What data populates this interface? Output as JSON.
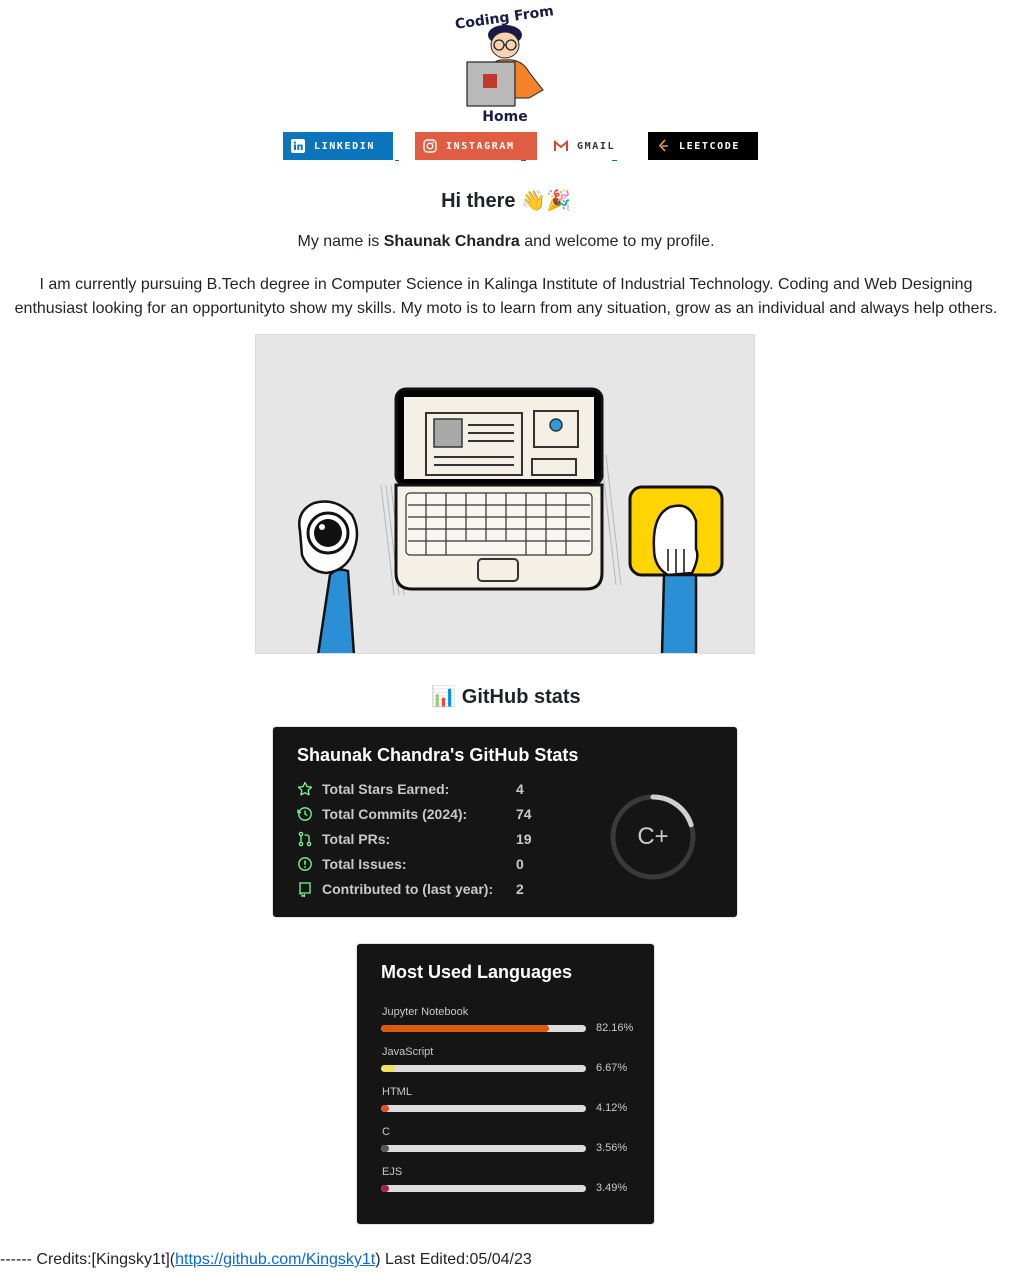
{
  "logo": {
    "top_text": "Coding From",
    "bottom_text": "Home"
  },
  "badges": [
    {
      "label": "LINKEDIN",
      "icon": "linkedin-icon",
      "color": "#0a75bd"
    },
    {
      "label": "INSTAGRAM",
      "icon": "instagram-icon",
      "color": "#e05d44"
    },
    {
      "label": "GMAIL",
      "icon": "gmail-icon",
      "color": "#ffffff"
    },
    {
      "label": "LEETCODE",
      "icon": "leetcode-icon",
      "color": "#000000"
    }
  ],
  "intro": {
    "greeting": "Hi there 👋🎉",
    "name_prefix": "My name is ",
    "name": "Shaunak Chandra",
    "name_suffix": " and welcome to my profile.",
    "bio_line1": "I am currently pursuing B.Tech degree in Computer Science in Kalinga Institute of Industrial Technology. Coding and Web Designing",
    "bio_line2": "enthusiast looking for an opportunityto show my skills. My moto is to learn from any situation, grow as an individual and always help others."
  },
  "stats_heading": "📊 GitHub stats",
  "stats_card": {
    "title": "Shaunak Chandra's GitHub Stats",
    "rows": [
      {
        "label": "Total Stars Earned:",
        "value": "4",
        "icon": "star-icon"
      },
      {
        "label": "Total Commits (2024):",
        "value": "74",
        "icon": "history-icon"
      },
      {
        "label": "Total PRs:",
        "value": "19",
        "icon": "pull-request-icon"
      },
      {
        "label": "Total Issues:",
        "value": "0",
        "icon": "issue-icon"
      },
      {
        "label": "Contributed to (last year):",
        "value": "2",
        "icon": "repo-icon"
      }
    ],
    "rank": "C+",
    "rank_progress": 0.2,
    "accent": "#79ff97"
  },
  "languages_card": {
    "title": "Most Used Languages",
    "languages": [
      {
        "name": "Jupyter Notebook",
        "percent": 82.16,
        "label": "82.16%",
        "color": "#DA5B0B"
      },
      {
        "name": "JavaScript",
        "percent": 6.67,
        "label": "6.67%",
        "color": "#f1e05a"
      },
      {
        "name": "HTML",
        "percent": 4.12,
        "label": "4.12%",
        "color": "#e34c26"
      },
      {
        "name": "C",
        "percent": 3.56,
        "label": "3.56%",
        "color": "#555555"
      },
      {
        "name": "EJS",
        "percent": 3.49,
        "label": "3.49%",
        "color": "#a91e50"
      }
    ]
  },
  "footer": {
    "prefix": "------ Credits:[Kingsky1t](",
    "link": "https://github.com/Kingsky1t",
    "suffix": ") Last Edited:05/04/23"
  }
}
